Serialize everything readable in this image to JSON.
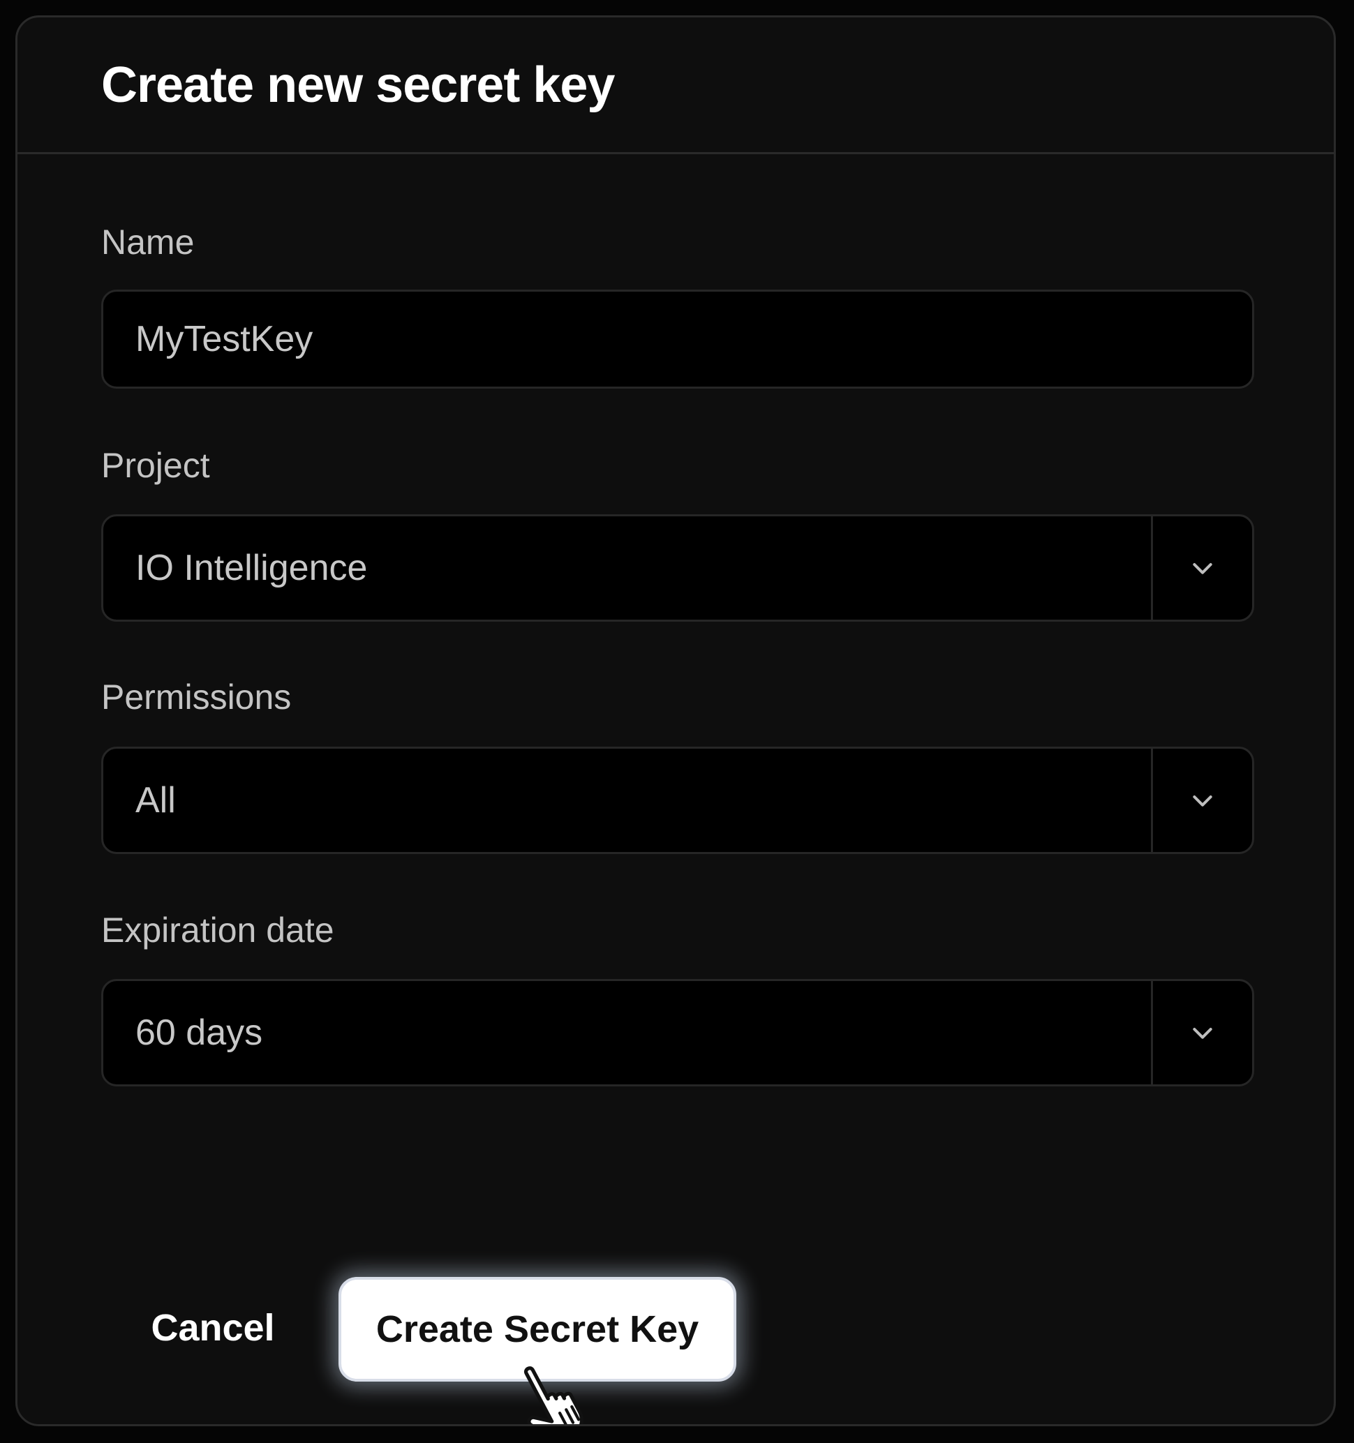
{
  "dialog": {
    "title": "Create new secret key"
  },
  "fields": {
    "name": {
      "label": "Name",
      "value": "MyTestKey"
    },
    "project": {
      "label": "Project",
      "value": "IO Intelligence"
    },
    "permissions": {
      "label": "Permissions",
      "value": "All"
    },
    "expiration": {
      "label": "Expiration date",
      "value": "60 days"
    }
  },
  "actions": {
    "cancel_label": "Cancel",
    "create_label": "Create Secret Key"
  },
  "icons": {
    "select_toggle": "chevron-down-icon",
    "pointer": "hand-pointer-icon"
  },
  "colors": {
    "background": "#0e0e0e",
    "border": "#2a2a2a",
    "input_background": "#000000",
    "primary_button": "#ffffff",
    "text_primary": "#ffffff",
    "text_secondary": "#c4c4c4"
  }
}
